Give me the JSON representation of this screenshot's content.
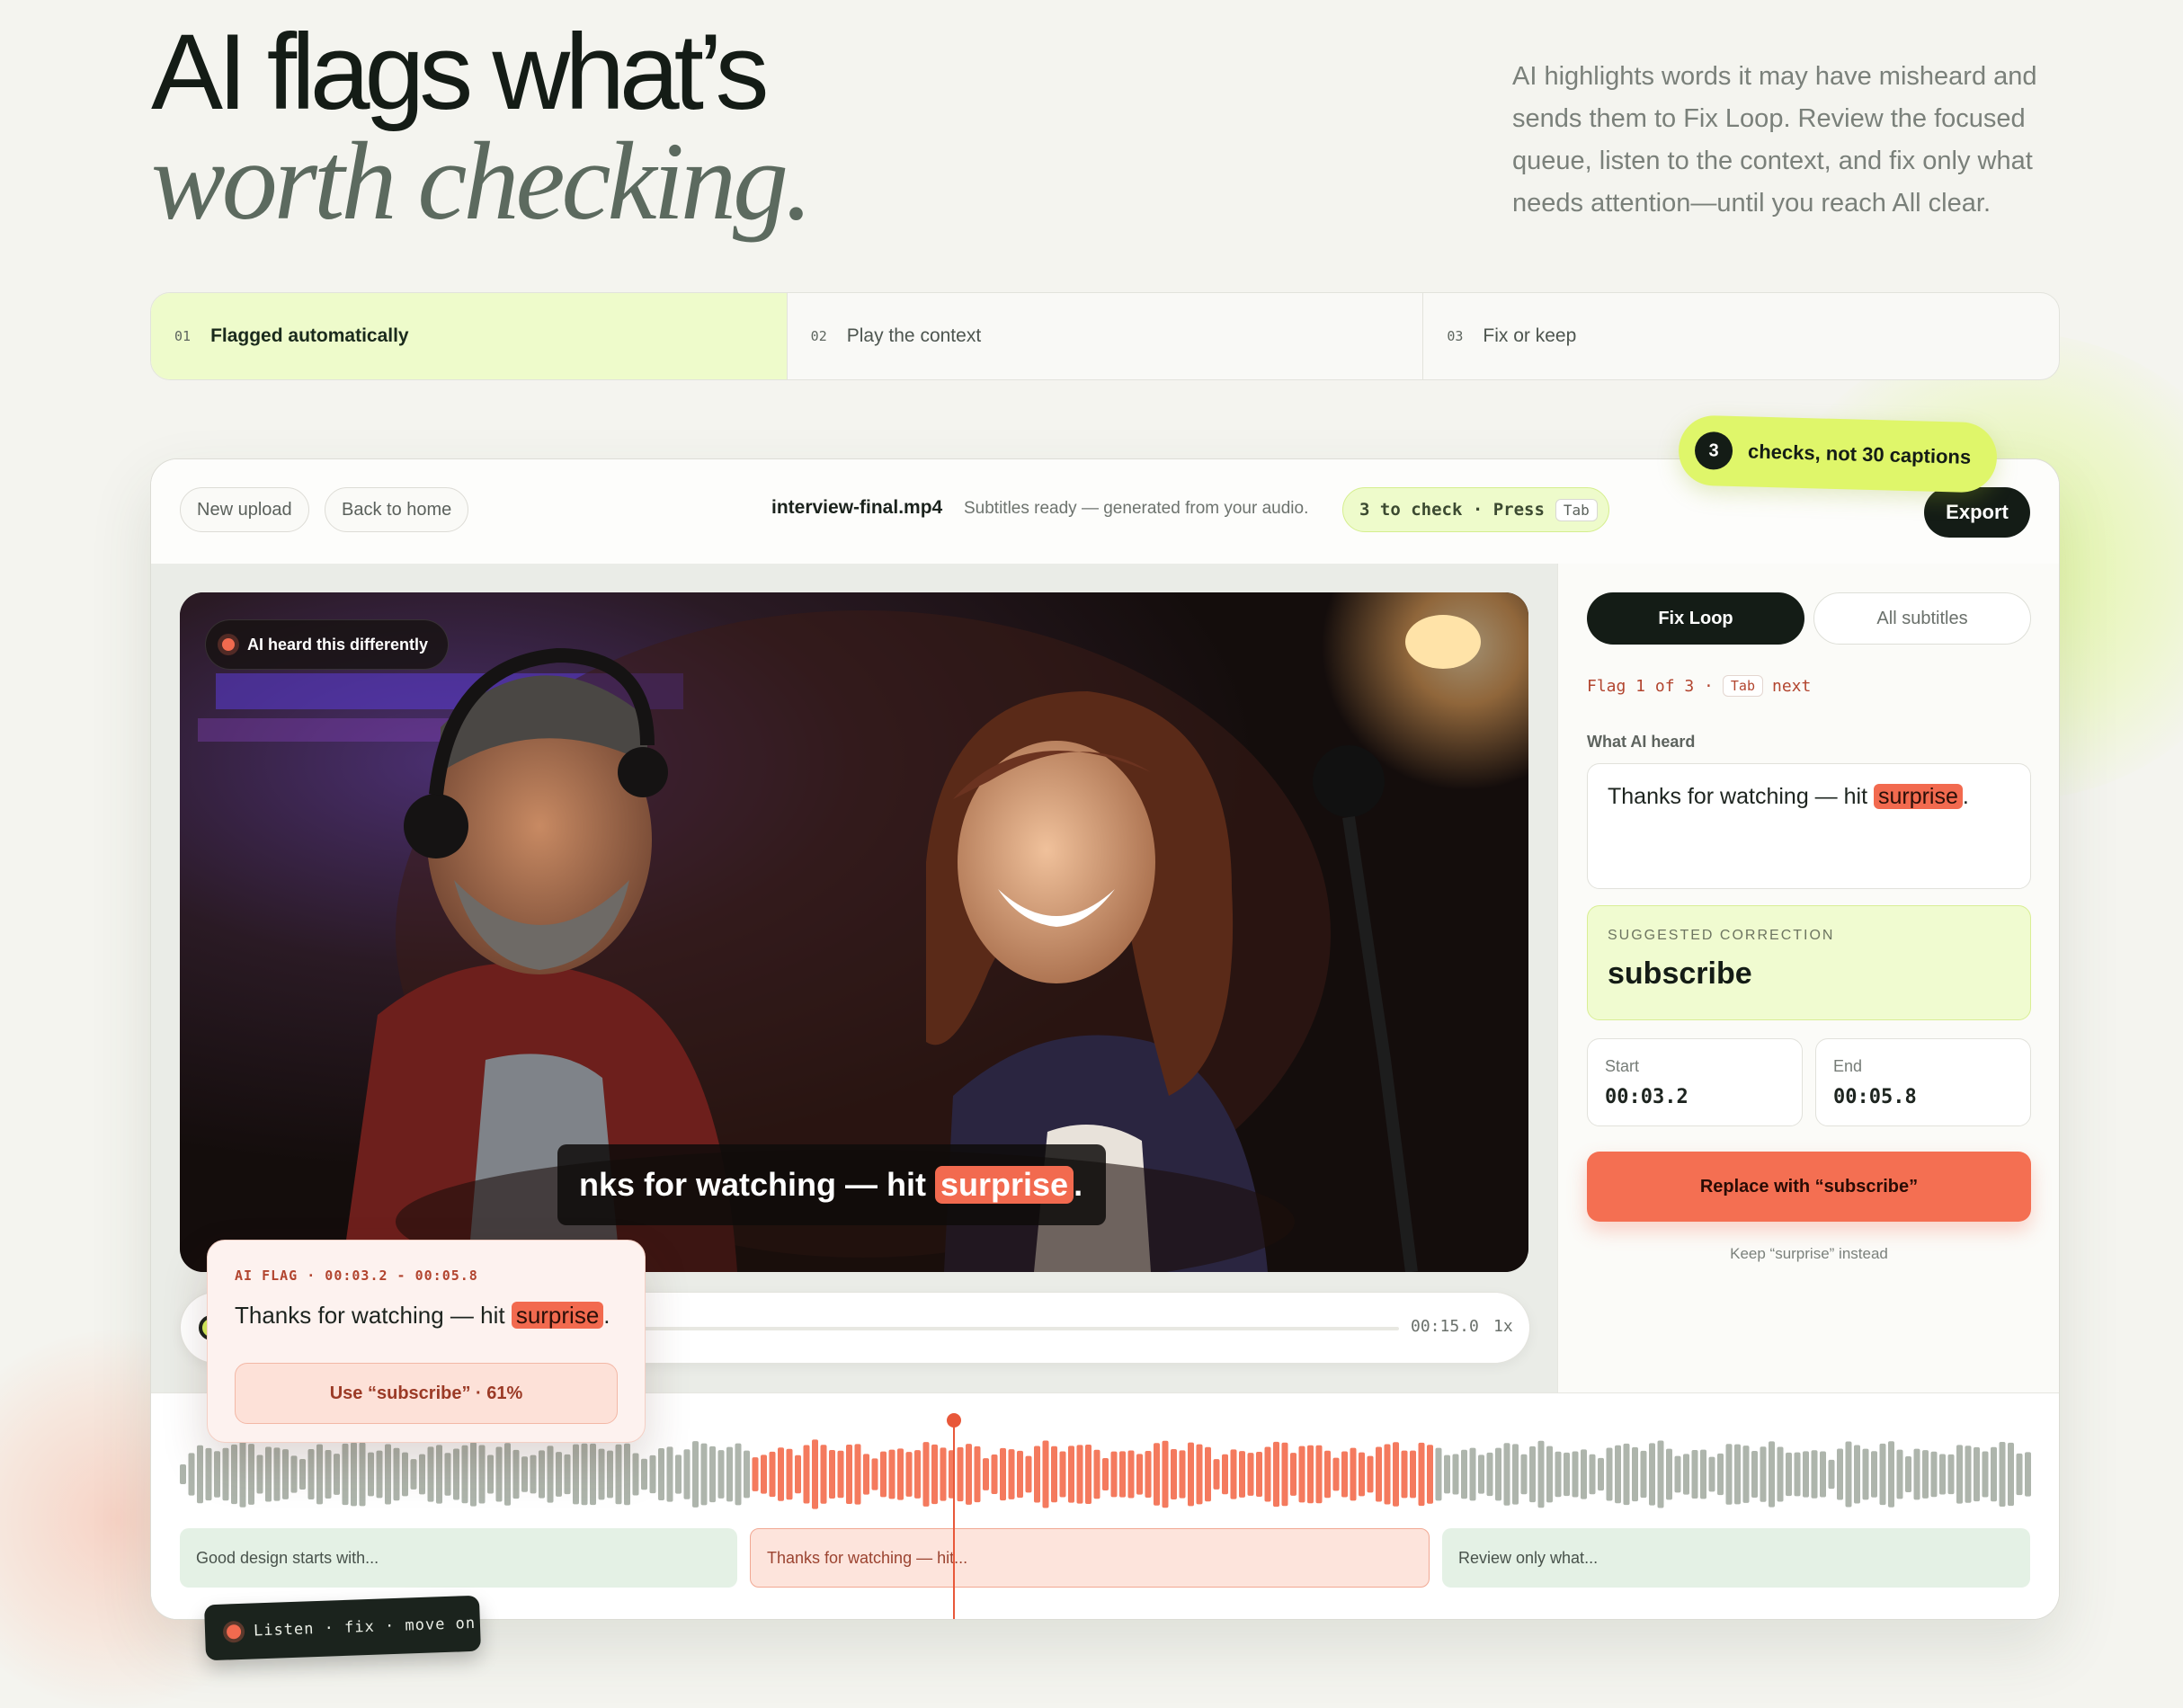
{
  "hero": {
    "title_line1": "AI flags what’s",
    "title_line2": "worth checking.",
    "description": "AI highlights words it may have misheard and sends them to Fix Loop. Review the focused queue, listen to the context, and fix only what needs attention—until you reach All clear."
  },
  "steps": [
    {
      "num": "01",
      "label": "Flagged automatically",
      "active": true
    },
    {
      "num": "02",
      "label": "Play the context",
      "active": false
    },
    {
      "num": "03",
      "label": "Fix or keep",
      "active": false
    }
  ],
  "sticker": {
    "count": "3",
    "text": "checks, not 30 captions"
  },
  "topbar": {
    "new_upload": "New upload",
    "back_home": "Back to home",
    "filename": "interview-final.mp4",
    "status": "Subtitles ready — generated from your audio.",
    "check_count": "3 to check · Press",
    "tab_key": "Tab",
    "export": "Export"
  },
  "video": {
    "ai_chip": "AI heard this differently",
    "caption_before": "nks for watching — hit",
    "caption_flag": "surprise",
    "caption_after": "."
  },
  "player": {
    "time": "00:15.0",
    "speed": "1x"
  },
  "flag_card": {
    "meta": "AI FLAG · 00:03.2 - 00:05.8",
    "text_before": "Thanks for watching — hit ",
    "text_flag": "surprise",
    "text_after": ".",
    "button": "Use “subscribe” · 61%"
  },
  "panel": {
    "tab_fix": "Fix Loop",
    "tab_all": "All subtitles",
    "flag_pos": "Flag 1 of 3 ·",
    "tab_key": "Tab",
    "next": "next",
    "heard_label": "What AI heard",
    "heard_before": "Thanks for watching — hit ",
    "heard_flag": "surprise",
    "heard_after": ".",
    "suggest_label": "SUGGESTED CORRECTION",
    "suggest_value": "subscribe",
    "start_label": "Start",
    "start_value": "00:03.2",
    "end_label": "End",
    "end_value": "00:05.8",
    "replace_btn": "Replace with “subscribe”",
    "keep_link": "Keep “surprise” instead"
  },
  "timeline": {
    "segments": [
      {
        "text": "Good design starts with..."
      },
      {
        "text": "Thanks for watching — hit..."
      },
      {
        "text": "Review only what..."
      }
    ]
  },
  "bottom_chip": "Listen · fix · move on",
  "colors": {
    "accent": "#f26a4f",
    "lime": "#dff66a",
    "dark": "#141c16"
  }
}
